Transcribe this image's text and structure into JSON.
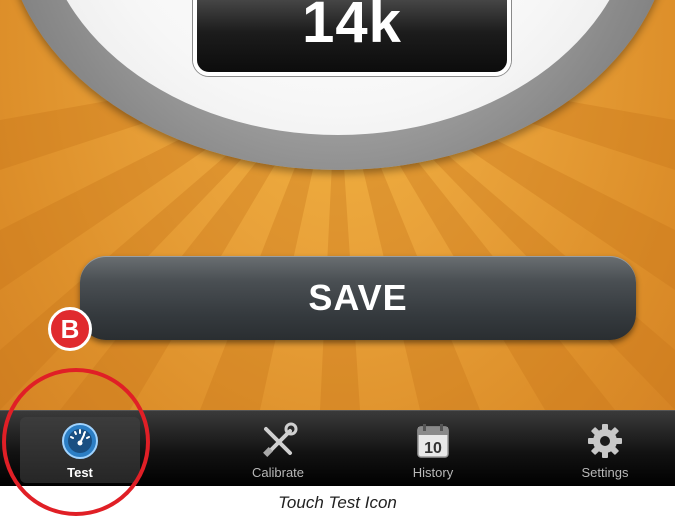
{
  "gauge": {
    "readout": "14k"
  },
  "actions": {
    "save_label": "SAVE"
  },
  "tabbar": {
    "items": [
      {
        "label": "Test",
        "icon": "gauge-icon",
        "active": true
      },
      {
        "label": "Calibrate",
        "icon": "tools-icon",
        "active": false
      },
      {
        "label": "History",
        "icon": "calendar-icon",
        "active": false
      },
      {
        "label": "Settings",
        "icon": "gear-icon",
        "active": false
      }
    ]
  },
  "calendar_icon_day": "10",
  "annotation": {
    "badge_letter": "B",
    "caption": "Touch Test Icon"
  },
  "colors": {
    "background_orange": "#e9a23a",
    "annotation_red": "#e01f26",
    "tab_active_blue": "#2c7ec4"
  }
}
